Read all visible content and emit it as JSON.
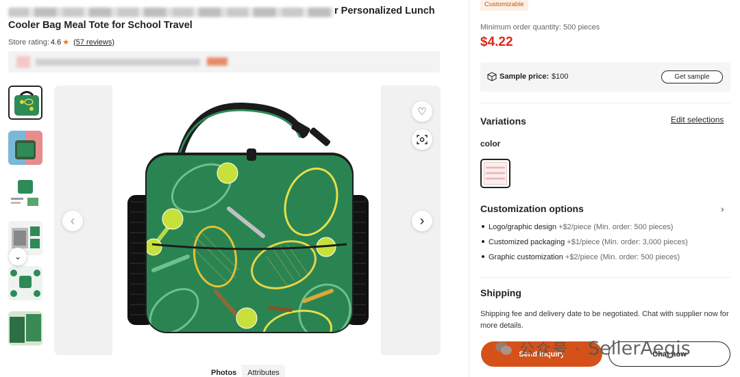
{
  "product": {
    "title_visible_part": "r Personalized Lunch",
    "title_line2": "Cooler Bag Meal Tote for School Travel"
  },
  "rating": {
    "label": "Store rating:",
    "score": "4.6",
    "reviews": "(57 reviews)"
  },
  "gallery": {
    "tabs": [
      "Photos",
      "Attributes"
    ],
    "icons": {
      "favorite": "heart-icon",
      "search_image": "image-search-icon",
      "prev": "chevron-left-icon",
      "next": "chevron-right-icon",
      "thumbs_down": "chevron-down-icon"
    },
    "glyphs": {
      "heart": "♡",
      "prev": "‹",
      "next": "›",
      "down": "⌄"
    }
  },
  "offer": {
    "badge": "Customizable",
    "min_order": "Minimum order quantity: 500 pieces",
    "price": "$4.22",
    "sample_label": "Sample price:",
    "sample_value": "$100",
    "sample_button": "Get sample"
  },
  "variations": {
    "title": "Variations",
    "edit": "Edit selections",
    "color_label": "color"
  },
  "customization": {
    "title": "Customization options",
    "options": [
      {
        "name": "Logo/graphic design",
        "detail": "+$2/piece (Min. order: 500 pieces)"
      },
      {
        "name": "Customized packaging",
        "detail": "+$1/piece (Min. order: 3,000 pieces)"
      },
      {
        "name": "Graphic customization",
        "detail": "+$2/piece (Min. order: 500 pieces)"
      }
    ]
  },
  "shipping": {
    "title": "Shipping",
    "text": "Shipping fee and delivery date to be negotiated. Chat with supplier now for more details."
  },
  "actions": {
    "send_inquiry": "Send inquiry",
    "chat_now": "Chat now"
  },
  "watermark": {
    "cn": "公众号 ·",
    "en": "SellerAegis"
  },
  "colors": {
    "price_red": "#e0261b",
    "brand_orange": "#d4511a",
    "star_orange": "#ff6a00",
    "bag_green": "#2e8a57"
  }
}
